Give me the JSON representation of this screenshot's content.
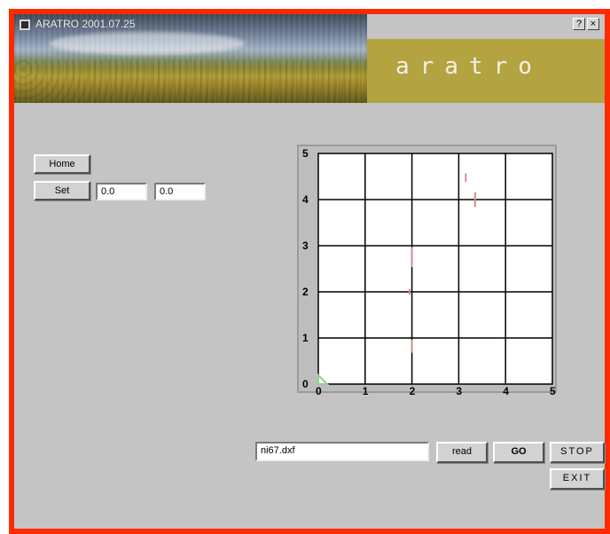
{
  "window": {
    "title": "ARATRO 2001.07.25",
    "brand": "aratro",
    "title_buttons": {
      "help": "?",
      "close": "×"
    }
  },
  "controls": {
    "home_label": "Home",
    "set_label": "Set",
    "set_x_value": "0.0",
    "set_y_value": "0.0"
  },
  "plot": {
    "x_ticks": [
      "0",
      "1",
      "2",
      "3",
      "4",
      "5"
    ],
    "y_ticks": [
      "0",
      "1",
      "2",
      "3",
      "4",
      "5"
    ],
    "colors": {
      "grid": "#000000",
      "marks": "#d38f8f",
      "origin": "#8fd08f"
    }
  },
  "file": {
    "filename": "ni67.dxf",
    "read_label": "read",
    "go_label": "GO",
    "stop_label": "STOP",
    "exit_label": "EXIT"
  }
}
